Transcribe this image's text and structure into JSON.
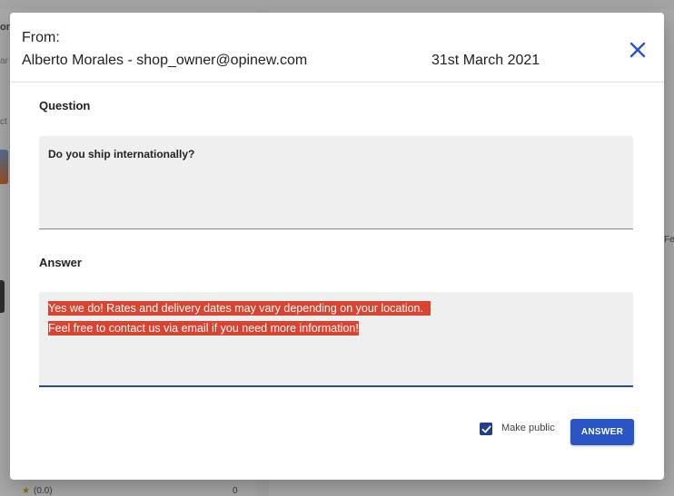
{
  "background": {
    "left_header_fragment": "or",
    "left_search_fragment": "ar",
    "left_col_fragment": "ct",
    "right_fragment": "Fee",
    "rating_star": "★",
    "rating_text": "(0.0)",
    "rating_count": "0"
  },
  "dialog": {
    "from_label": "From:",
    "from_value": "Alberto Morales - shop_owner@opinew.com",
    "date": "31st March 2021",
    "close_icon": "close-icon",
    "question_label": "Question",
    "question_text": "Do you ship internationally?",
    "answer_label": "Answer",
    "answer_lines": [
      "Yes we do! Rates and delivery dates may vary depending on your location.",
      "Feel free to contact us via email if you need more information!"
    ],
    "make_public_label": "Make public",
    "make_public_checked": true,
    "answer_button_label": "ANSWER"
  },
  "colors": {
    "accent": "#2a55c4",
    "close_icon": "#2a55c4",
    "selection_highlight": "#d9432f",
    "checkbox": "#1e3f8a"
  }
}
